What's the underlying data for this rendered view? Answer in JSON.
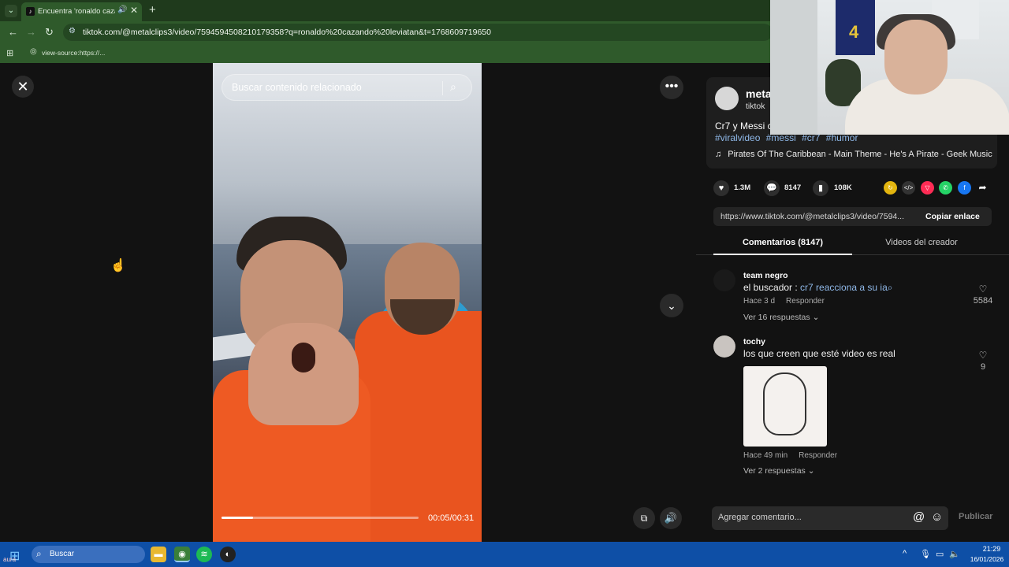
{
  "browser": {
    "tab_title": "Encuentra 'ronaldo cazando",
    "url": "tiktok.com/@metalclips3/video/7594594508210179358?q=ronaldo%20cazando%20leviatan&t=1768609719650",
    "bookmark_label": "view-source:https://..."
  },
  "video": {
    "search_placeholder": "Buscar contenido relacionado",
    "time": "00:05/00:31",
    "progress": 0.16
  },
  "post": {
    "author_name": "meta",
    "author_sub": "tiktok",
    "description": "Cr7 y Messi c",
    "hashtags": [
      "#viralvideo",
      "#messi",
      "#cr7",
      "#humor"
    ],
    "music": "Pirates Of The Caribbean - Main Theme - He's A Pirate - Geek Music",
    "likes": "1.3M",
    "comments": "8147",
    "saves": "108K",
    "link": "https://www.tiktok.com/@metalclips3/video/7594...",
    "copy_link": "Copiar enlace"
  },
  "tabs": {
    "comments": "Comentarios (8147)",
    "creator": "Videos del creador"
  },
  "comments": [
    {
      "user": "team negro",
      "text_prefix": "el buscador : ",
      "text_link": "cr7 reacciona a su ia",
      "time": "Hace 3 d",
      "reply": "Responder",
      "likes": "5584",
      "replies": "Ver 16 respuestas"
    },
    {
      "user": "tochy",
      "text": "los que creen que esté video es real",
      "time": "Hace 49 min",
      "reply": "Responder",
      "likes": "9",
      "replies": "Ver 2 respuestas"
    }
  ],
  "comment_input": {
    "placeholder": "Agregar comentario...",
    "publish": "Publicar"
  },
  "taskbar": {
    "search": "Buscar",
    "aura_label": "aura",
    "time": "21:29",
    "date": "16/01/2026"
  },
  "colors": {
    "accent_link": "#8fb8e8",
    "chrome_green": "#2f5a2b",
    "taskbar_blue": "#0e4fa6"
  }
}
